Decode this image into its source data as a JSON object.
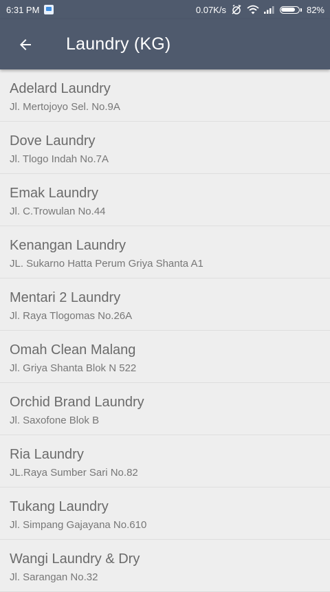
{
  "status_bar": {
    "time": "6:31 PM",
    "network_speed": "0.07K/s",
    "battery_percent": "82%",
    "battery_level": 0.82,
    "icons": [
      "notification-icon",
      "alarm-off-icon",
      "wifi-icon",
      "signal-icon",
      "battery-icon"
    ]
  },
  "app_bar": {
    "title": "Laundry (KG)",
    "back_icon": "arrow-back-icon"
  },
  "laundries": [
    {
      "name": "Adelard Laundry",
      "address": "Jl. Mertojoyo Sel. No.9A"
    },
    {
      "name": "Dove Laundry",
      "address": "Jl. Tlogo Indah No.7A"
    },
    {
      "name": "Emak Laundry",
      "address": "Jl. C.Trowulan No.44"
    },
    {
      "name": "Kenangan Laundry",
      "address": "JL. Sukarno Hatta Perum Griya Shanta A1"
    },
    {
      "name": "Mentari 2 Laundry",
      "address": "Jl. Raya Tlogomas No.26A"
    },
    {
      "name": "Omah Clean Malang",
      "address": "Jl. Griya Shanta Blok N 522"
    },
    {
      "name": "Orchid Brand Laundry",
      "address": "Jl. Saxofone Blok B"
    },
    {
      "name": "Ria Laundry",
      "address": "JL.Raya Sumber Sari No.82"
    },
    {
      "name": "Tukang Laundry",
      "address": "Jl. Simpang Gajayana No.610"
    },
    {
      "name": "Wangi Laundry & Dry",
      "address": "Jl. Sarangan No.32"
    }
  ],
  "colors": {
    "app_bar": "#4f5a6d",
    "background": "#eeeeee",
    "primary_text": "#6a6a6a",
    "secondary_text": "#777777"
  }
}
